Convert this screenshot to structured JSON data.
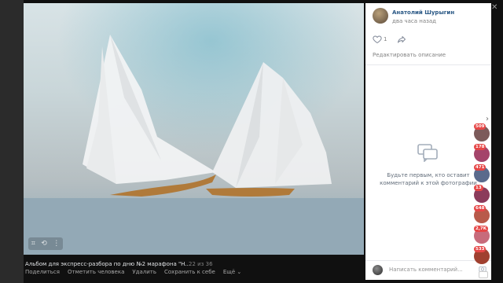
{
  "viewer": {
    "album_title": "Альбом для экспресс-разбора по дню №2 марафона \"Н...",
    "counter": "22 из 36",
    "actions": [
      "Поделиться",
      "Отметить человека",
      "Удалить",
      "Сохранить к себе",
      "Ещё ⌄"
    ],
    "photo_overlay_icons": [
      "crop-icon",
      "rotate-icon",
      "more-icon"
    ]
  },
  "sidebar": {
    "author": "Анатолий Шурыгин",
    "time": "два часа назад",
    "likes": "1",
    "edit_description": "Редактировать описание",
    "empty_comments": "Будьте первым, кто оставит\nкомментарий к этой фотографии",
    "comment_placeholder": "Написать комментарий..."
  },
  "controls": {
    "close": "✕",
    "next": "›"
  },
  "rail": [
    {
      "badge": "509",
      "color": "#7c5a5a"
    },
    {
      "badge": "178",
      "color": "#a4446a"
    },
    {
      "badge": "471",
      "color": "#5a6a8c"
    },
    {
      "badge": "13",
      "color": "#8b3b5b"
    },
    {
      "badge": "648",
      "color": "#b85a4a"
    },
    {
      "badge": "2,7K",
      "color": "#c76b7b"
    },
    {
      "badge": "533",
      "color": "#a04030"
    }
  ]
}
